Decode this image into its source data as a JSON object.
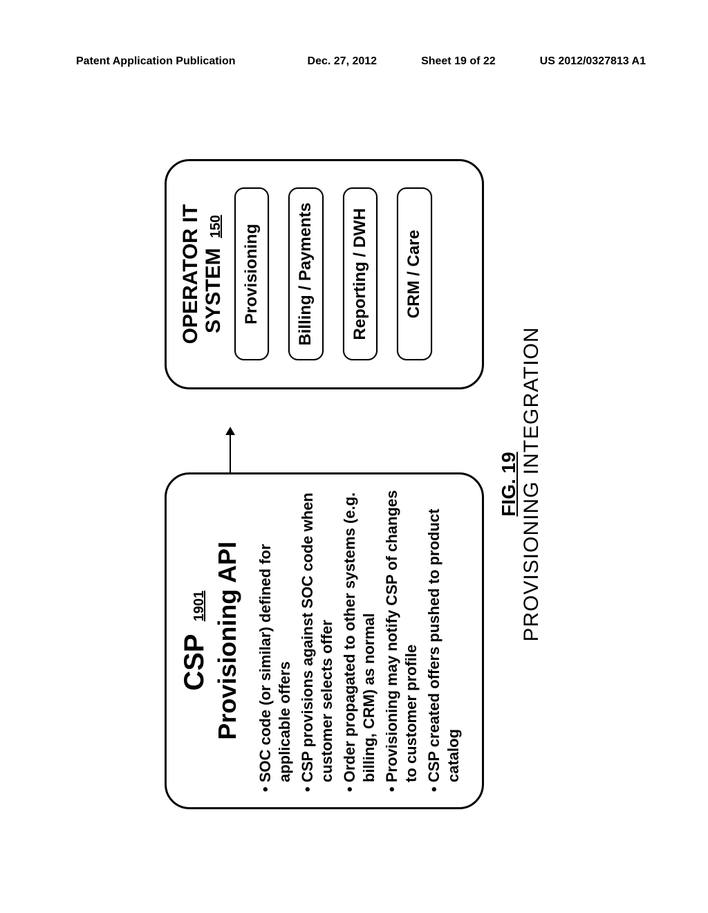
{
  "header": {
    "left": "Patent Application Publication",
    "date": "Dec. 27, 2012",
    "sheet": "Sheet 19 of 22",
    "pubno": "US 2012/0327813 A1"
  },
  "csp": {
    "title": "CSP",
    "refnum": "1901",
    "subtitle": "Provisioning API",
    "bullets": [
      "SOC code (or similar) defined for applicable offers",
      "CSP provisions against SOC code when customer selects offer",
      "Order propagated to other systems (e.g. billing, CRM) as normal",
      "Provisioning may notify CSP of changes to customer profile",
      "CSP created offers pushed to product catalog"
    ]
  },
  "operator": {
    "title_line1": "OPERATOR IT",
    "title_line2": "SYSTEM",
    "refnum": "150",
    "boxes": [
      "Provisioning",
      "Billing / Payments",
      "Reporting / DWH",
      "CRM / Care"
    ]
  },
  "caption": {
    "figno": "FIG. 19",
    "title": "PROVISIONING INTEGRATION"
  }
}
